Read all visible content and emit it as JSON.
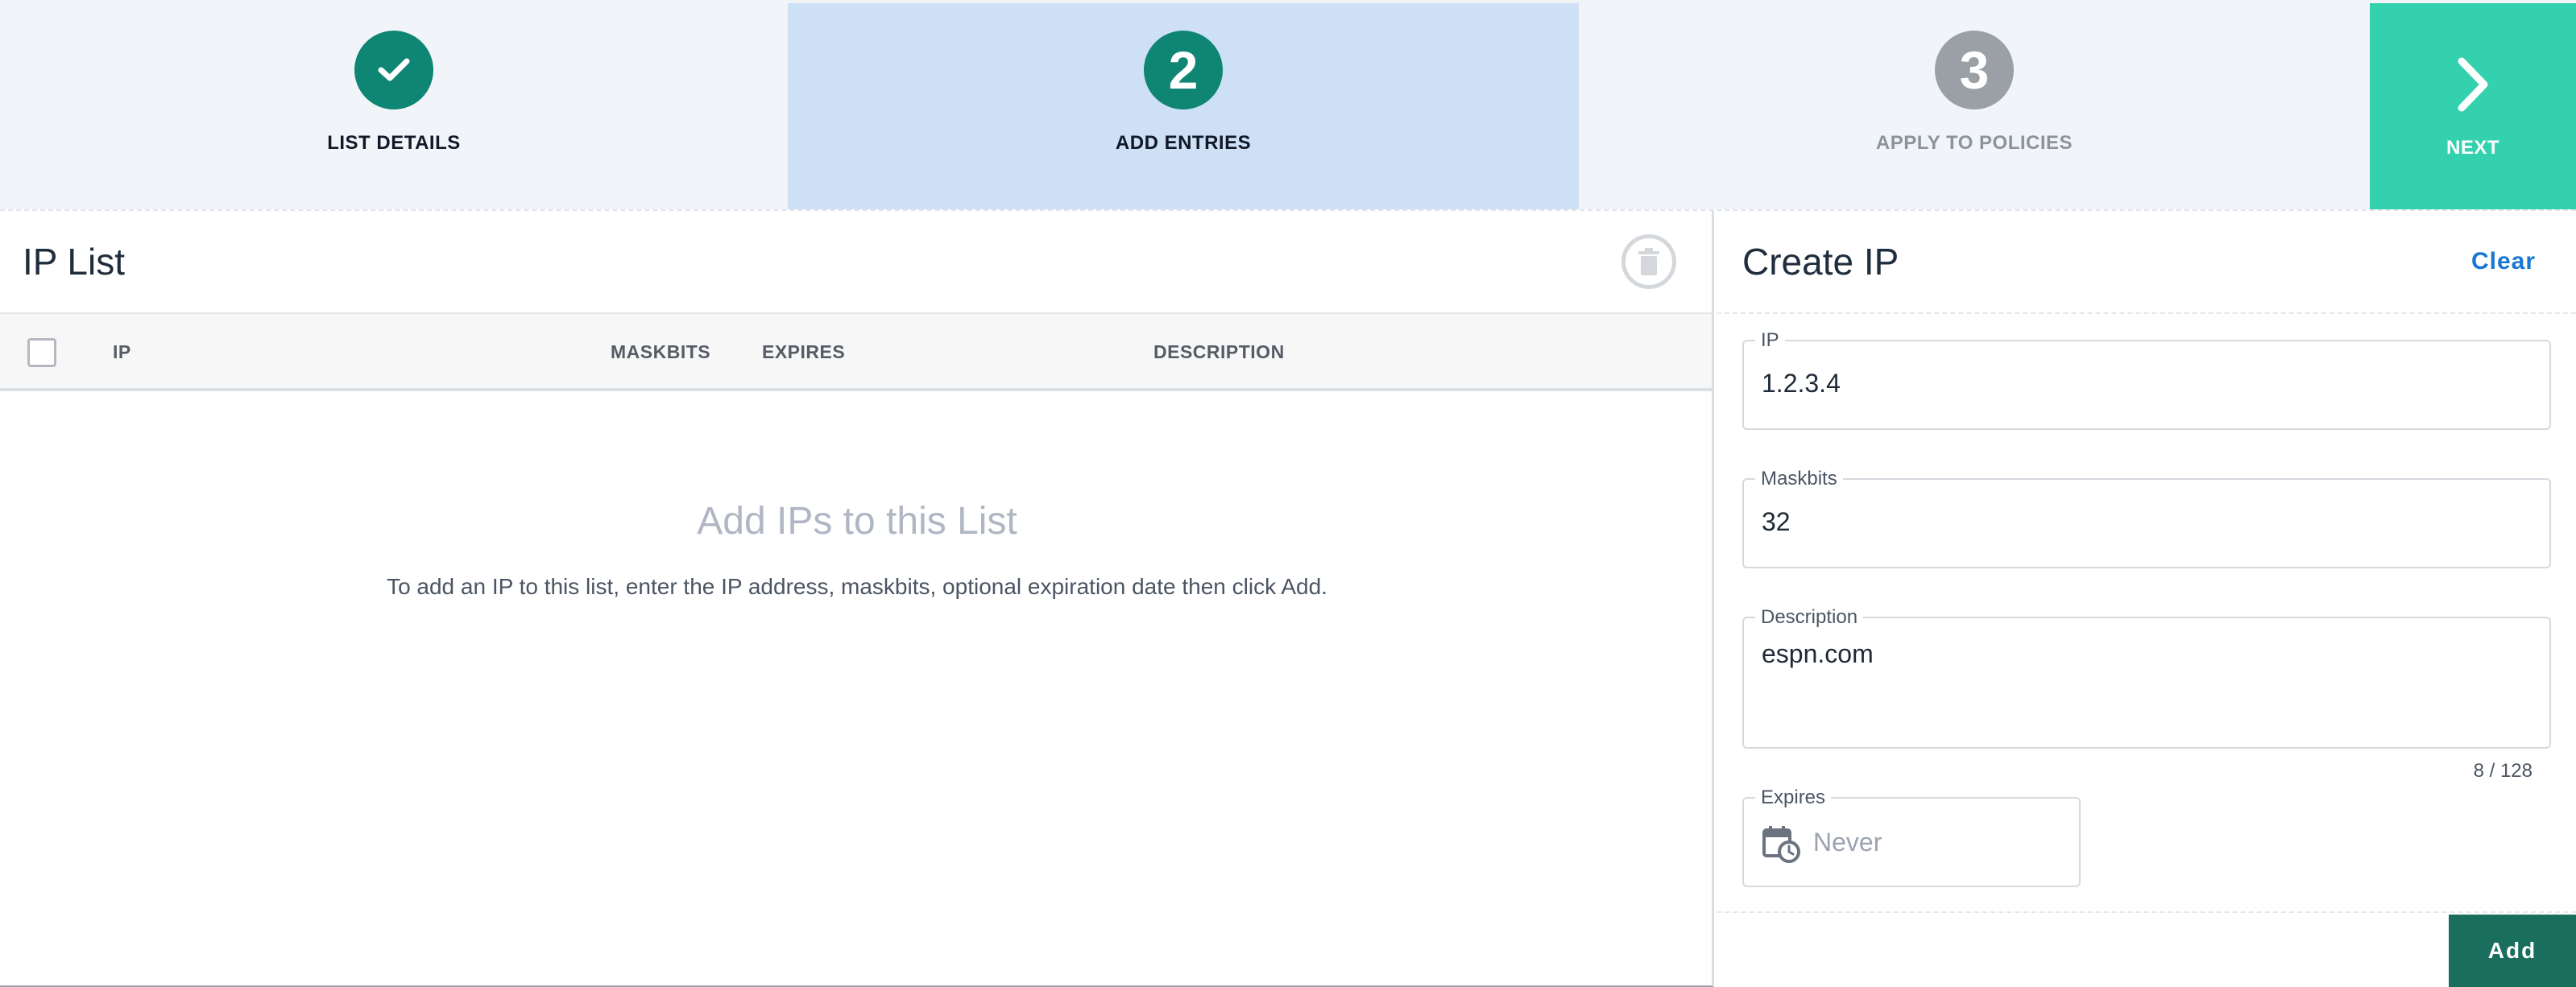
{
  "stepper": {
    "steps": [
      {
        "number": "",
        "label": "LIST DETAILS",
        "status": "complete",
        "icon": "check-icon"
      },
      {
        "number": "2",
        "label": "ADD ENTRIES",
        "status": "active"
      },
      {
        "number": "3",
        "label": "APPLY TO POLICIES",
        "status": "pending"
      }
    ],
    "next_label": "NEXT",
    "next_icon": "chevron-right-icon"
  },
  "ip_list": {
    "title": "IP List",
    "delete_icon": "trash-icon",
    "columns": [
      "IP",
      "MASKBITS",
      "EXPIRES",
      "DESCRIPTION"
    ],
    "rows": [],
    "empty_title": "Add IPs to this List",
    "empty_description": "To add an IP to this list, enter the IP address, maskbits, optional expiration date then click Add."
  },
  "create_ip": {
    "title": "Create IP",
    "clear_label": "Clear",
    "ip": {
      "label": "IP",
      "value": "1.2.3.4"
    },
    "maskbits": {
      "label": "Maskbits",
      "value": "32"
    },
    "description": {
      "label": "Description",
      "value": "espn.com",
      "counter": "8 / 128"
    },
    "expires": {
      "label": "Expires",
      "value": "Never",
      "icon": "calendar-clock-icon"
    },
    "add_label": "Add"
  },
  "colors": {
    "accent_green": "#0f8573",
    "next_teal": "#34d1ae",
    "active_step_bg": "#cde0f5",
    "add_button": "#1a6e5e",
    "link_blue": "#1877d4"
  }
}
